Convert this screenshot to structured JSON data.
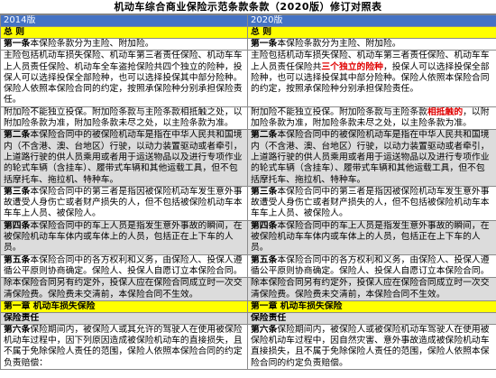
{
  "title": "机动车综合商业保险示范条款条款（2020版）修订对照表",
  "versions": {
    "left": "2014版",
    "right": "2020版"
  },
  "rows": [
    {
      "kind": "chap",
      "left": [
        {
          "t": "总 则"
        }
      ],
      "right": [
        {
          "t": "总 则"
        }
      ]
    },
    {
      "kind": "plain",
      "left": [
        {
          "t": "第一条",
          "b": true
        },
        {
          "t": "本保险条款分为主险、附加险。"
        }
      ],
      "right": [
        {
          "t": "第一条",
          "b": true
        },
        {
          "t": "本保险条款分为主险、附加险。"
        }
      ]
    },
    {
      "kind": "plain",
      "left": [
        {
          "t": "主险包括机动车损失保险、机动车第三者责任保险、机动车车上人员责任保险、机动车全车盗抢保险共四个独立的险种，投保人可以选择投保全部险种，也可以选择投保其中部分险种。保险人依照本保险合同的约定，按照承保险种分别承担保险责任。"
        }
      ],
      "right": [
        {
          "t": "主险包括机动车损失保险、机动车第三者责任保险、机动车车上人员责任保险共"
        },
        {
          "t": "三个独立的险种",
          "r": true
        },
        {
          "t": "，投保人可以选择投保全部险种，也可以选择投保其中部分险种。保险人依照本保险合同的约定，按照承保险种分别承担保险责任。"
        }
      ]
    },
    {
      "kind": "plain",
      "left": [
        {
          "t": "附加险不能独立投保。附加险条款与主险条款相抵触之处，以附加险条款为准，附加险条款未尽之处，以主险条款为准。"
        }
      ],
      "right": [
        {
          "t": "附加险不能独立投保。附加险条款与主险条款"
        },
        {
          "t": "相抵触的",
          "r": true
        },
        {
          "t": "，以附加险条款为准，附加险条款未尽之处，以主险条款为准。"
        }
      ]
    },
    {
      "kind": "gray",
      "left": [
        {
          "t": "第二条",
          "b": true
        },
        {
          "t": "本保险合同中的被保险机动车是指在中华人民共和国境内（不含港、澳、台地区）行驶，以动力装置驱动或者牵引，上道路行驶的供人员乘用或者用于运送物品以及进行专项作业的轮式车辆（含挂车）、履带式车辆和其他运载工具，但不包括摩托车、拖拉机、特种车。"
        }
      ],
      "right": [
        {
          "t": "第二条",
          "b": true
        },
        {
          "t": "本保险合同中的被保险机动车是指在中华人民共和国境内（不含港、澳、台地区）行驶，以动力装置驱动或者牵引，上道路行驶的供人员乘用或者用于运送物品以及进行专项作业的轮式车辆（含挂车）、履带式车辆和其他运载工具，但不包括摩托车、拖拉机、特种车。"
        }
      ]
    },
    {
      "kind": "plain",
      "left": [
        {
          "t": "第三条",
          "b": true
        },
        {
          "t": "本保险合同中的第三者是指因被保险机动车发生意外事故遭受人身伤亡或者财产损失的人，但不包括被保险机动车本车车上人员、被保险人。"
        }
      ],
      "right": [
        {
          "t": "第三条",
          "b": true
        },
        {
          "t": "本保险合同中的第三者是指因被保险机动车发生意外事故遭受人身伤亡或者财产损失的人，但不包括被保险机动车本车车上人员、被保险人。"
        }
      ]
    },
    {
      "kind": "gray",
      "left": [
        {
          "t": "第四条",
          "b": true
        },
        {
          "t": "本保险合同中的车上人员是指发生意外事故的瞬间，在被保险机动车车体内或车体上的人员，包括正在上下车的人员。"
        }
      ],
      "right": [
        {
          "t": "第四条",
          "b": true
        },
        {
          "t": "本保险合同中的车上人员是指发生意外事故的瞬间，在被保险机动车车体内或车体上的人员，包括正在上下车的人员。"
        }
      ]
    },
    {
      "kind": "plain",
      "left": [
        {
          "t": "第五条",
          "b": true
        },
        {
          "t": "本保险合同中的各方权利和义务，由保险人、投保人遵循公平原则协商确定。保险人、投保人自愿订立本保险合同。"
        }
      ],
      "right": [
        {
          "t": "第五条",
          "b": true
        },
        {
          "t": "本保险合同中的各方权利和义务，由保险人、投保人遵循公平原则协商确定。保险人、投保人自愿订立本保险合同。"
        }
      ]
    },
    {
      "kind": "gray",
      "left": [
        {
          "t": "除本保险合同另有约定外，投保人应在保险合同成立时一次交清保险费。保险费未交清前，本保险合同不生效。"
        }
      ],
      "right": [
        {
          "t": "除本保险合同另有约定外，投保人应在保险合同成立时一次交清保险费。保险费未交清前，本保险合同不生效。"
        }
      ]
    },
    {
      "kind": "chap",
      "left": [
        {
          "t": "第一章 机动车损失保险"
        }
      ],
      "right": [
        {
          "t": "第一章 机动车损失保险"
        }
      ]
    },
    {
      "kind": "sec",
      "left": [
        {
          "t": "保险责任"
        }
      ],
      "right": [
        {
          "t": "保险责任"
        }
      ]
    },
    {
      "kind": "plain",
      "left": [
        {
          "t": "第六条",
          "b": true
        },
        {
          "t": "保险期间内，被保险人或其允许的驾驶人在使用被保险机动车过程中，因下列原因造成被保险机动车的直接损失，且不属于免除保险人责任的范围，保险人依照本保险合同的约定负责赔偿："
        }
      ],
      "right": [
        {
          "t": "第六条",
          "b": true
        },
        {
          "t": "保险期间内，被保险人或被保险机动车驾驶人在使用被保险机动车过程中，因自然灾害、意外事故造成被保险机动车直接损失，且不属于免除保险人责任的范围，保险人依照本保险合同的约定负责赔偿。"
        }
      ]
    }
  ]
}
